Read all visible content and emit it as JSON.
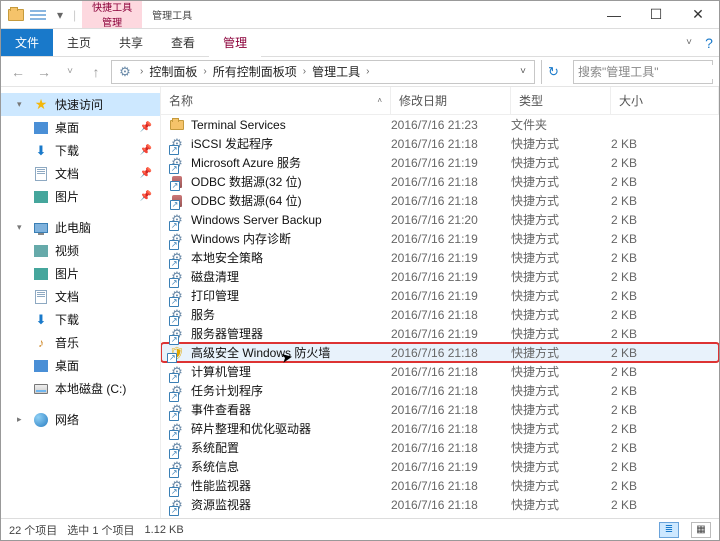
{
  "titlebar": {
    "context_tabs": [
      {
        "group": "快捷工具",
        "tab": "管理"
      },
      {
        "group": "管理工具",
        "tab": ""
      }
    ]
  },
  "ribbon": {
    "file": "文件",
    "tabs": [
      "主页",
      "共享",
      "查看",
      "管理"
    ]
  },
  "address": {
    "parts": [
      "控制面板",
      "所有控制面板项",
      "管理工具"
    ],
    "search_placeholder": "搜索\"管理工具\""
  },
  "columns": {
    "name": "名称",
    "date": "修改日期",
    "type": "类型",
    "size": "大小"
  },
  "nav": {
    "quick_access": "快速访问",
    "desktop": "桌面",
    "downloads": "下载",
    "documents": "文档",
    "pictures": "图片",
    "this_pc": "此电脑",
    "videos": "视频",
    "pictures2": "图片",
    "documents2": "文档",
    "downloads2": "下载",
    "music": "音乐",
    "desktop2": "桌面",
    "local_disk": "本地磁盘 (C:)",
    "network": "网络"
  },
  "items": [
    {
      "name": "Terminal Services",
      "date": "2016/7/16 21:23",
      "type": "文件夹",
      "size": "",
      "kind": "folder"
    },
    {
      "name": "iSCSI 发起程序",
      "date": "2016/7/16 21:18",
      "type": "快捷方式",
      "size": "2 KB",
      "kind": "gear"
    },
    {
      "name": "Microsoft Azure 服务",
      "date": "2016/7/16 21:19",
      "type": "快捷方式",
      "size": "2 KB",
      "kind": "gear"
    },
    {
      "name": "ODBC 数据源(32 位)",
      "date": "2016/7/16 21:18",
      "type": "快捷方式",
      "size": "2 KB",
      "kind": "db"
    },
    {
      "name": "ODBC 数据源(64 位)",
      "date": "2016/7/16 21:18",
      "type": "快捷方式",
      "size": "2 KB",
      "kind": "db"
    },
    {
      "name": "Windows Server Backup",
      "date": "2016/7/16 21:20",
      "type": "快捷方式",
      "size": "2 KB",
      "kind": "gear"
    },
    {
      "name": "Windows 内存诊断",
      "date": "2016/7/16 21:19",
      "type": "快捷方式",
      "size": "2 KB",
      "kind": "gear"
    },
    {
      "name": "本地安全策略",
      "date": "2016/7/16 21:19",
      "type": "快捷方式",
      "size": "2 KB",
      "kind": "gear"
    },
    {
      "name": "磁盘清理",
      "date": "2016/7/16 21:19",
      "type": "快捷方式",
      "size": "2 KB",
      "kind": "gear"
    },
    {
      "name": "打印管理",
      "date": "2016/7/16 21:19",
      "type": "快捷方式",
      "size": "2 KB",
      "kind": "gear"
    },
    {
      "name": "服务",
      "date": "2016/7/16 21:18",
      "type": "快捷方式",
      "size": "2 KB",
      "kind": "gear"
    },
    {
      "name": "服务器管理器",
      "date": "2016/7/16 21:19",
      "type": "快捷方式",
      "size": "2 KB",
      "kind": "gear"
    },
    {
      "name": "高级安全 Windows 防火墙",
      "date": "2016/7/16 21:18",
      "type": "快捷方式",
      "size": "2 KB",
      "kind": "shield",
      "highlight": true
    },
    {
      "name": "计算机管理",
      "date": "2016/7/16 21:18",
      "type": "快捷方式",
      "size": "2 KB",
      "kind": "gear"
    },
    {
      "name": "任务计划程序",
      "date": "2016/7/16 21:18",
      "type": "快捷方式",
      "size": "2 KB",
      "kind": "gear"
    },
    {
      "name": "事件查看器",
      "date": "2016/7/16 21:18",
      "type": "快捷方式",
      "size": "2 KB",
      "kind": "gear"
    },
    {
      "name": "碎片整理和优化驱动器",
      "date": "2016/7/16 21:18",
      "type": "快捷方式",
      "size": "2 KB",
      "kind": "gear"
    },
    {
      "name": "系统配置",
      "date": "2016/7/16 21:18",
      "type": "快捷方式",
      "size": "2 KB",
      "kind": "gear"
    },
    {
      "name": "系统信息",
      "date": "2016/7/16 21:19",
      "type": "快捷方式",
      "size": "2 KB",
      "kind": "gear"
    },
    {
      "name": "性能监视器",
      "date": "2016/7/16 21:18",
      "type": "快捷方式",
      "size": "2 KB",
      "kind": "gear"
    },
    {
      "name": "资源监视器",
      "date": "2016/7/16 21:18",
      "type": "快捷方式",
      "size": "2 KB",
      "kind": "gear"
    }
  ],
  "status": {
    "count": "22 个项目",
    "selection": "选中 1 个项目",
    "size": "1.12 KB"
  }
}
